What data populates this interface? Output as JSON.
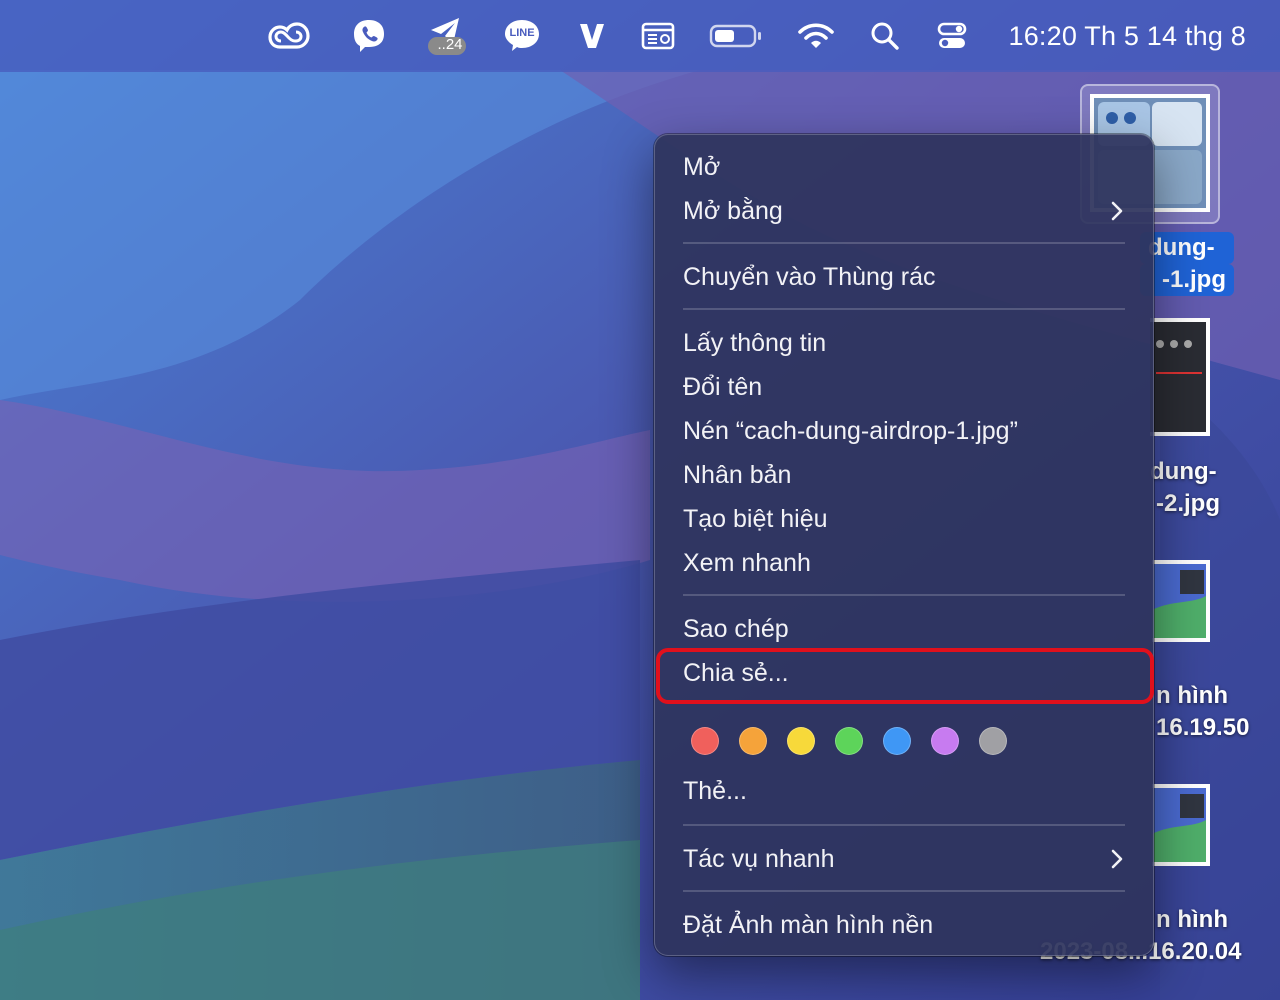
{
  "menubar": {
    "clock": "16:20 Th 5 14 thg 8",
    "telegram_badge": "..24",
    "line_label": "LINE",
    "icons": [
      "creative-cloud-icon",
      "viber-icon",
      "telegram-icon",
      "line-icon",
      "v-app-icon",
      "keyboard-shortcut-icon",
      "battery-icon",
      "wifi-icon",
      "search-icon",
      "control-center-icon"
    ]
  },
  "desktop": {
    "files": [
      {
        "label_line1": "dung-",
        "label_line2": "-1.jpg",
        "selected": true
      },
      {
        "label_line1": "dung-",
        "label_line2": "-2.jpg",
        "selected": false
      },
      {
        "label_line1": "n hình",
        "label_line2": "16.19.50",
        "selected": false
      },
      {
        "label_line1": "n hình",
        "label_line2": "2023-08...16.20.04",
        "selected": false
      }
    ]
  },
  "context_menu": {
    "open": "Mở",
    "open_with": "Mở bằng",
    "move_to_trash": "Chuyển vào Thùng rác",
    "get_info": "Lấy thông tin",
    "rename": "Đổi tên",
    "compress": "Nén “cach-dung-airdrop-1.jpg”",
    "duplicate": "Nhân bản",
    "make_alias": "Tạo biệt hiệu",
    "quick_look": "Xem nhanh",
    "copy": "Sao chép",
    "share": "Chia sẻ...",
    "tags": "Thẻ...",
    "quick_actions": "Tác vụ nhanh",
    "set_desktop_picture": "Đặt Ảnh màn hình nền",
    "tag_colors": [
      "#f0605c",
      "#f5a33a",
      "#f7d93a",
      "#5dd45a",
      "#3f97f5",
      "#c77bf0",
      "#a0a0a4"
    ]
  }
}
